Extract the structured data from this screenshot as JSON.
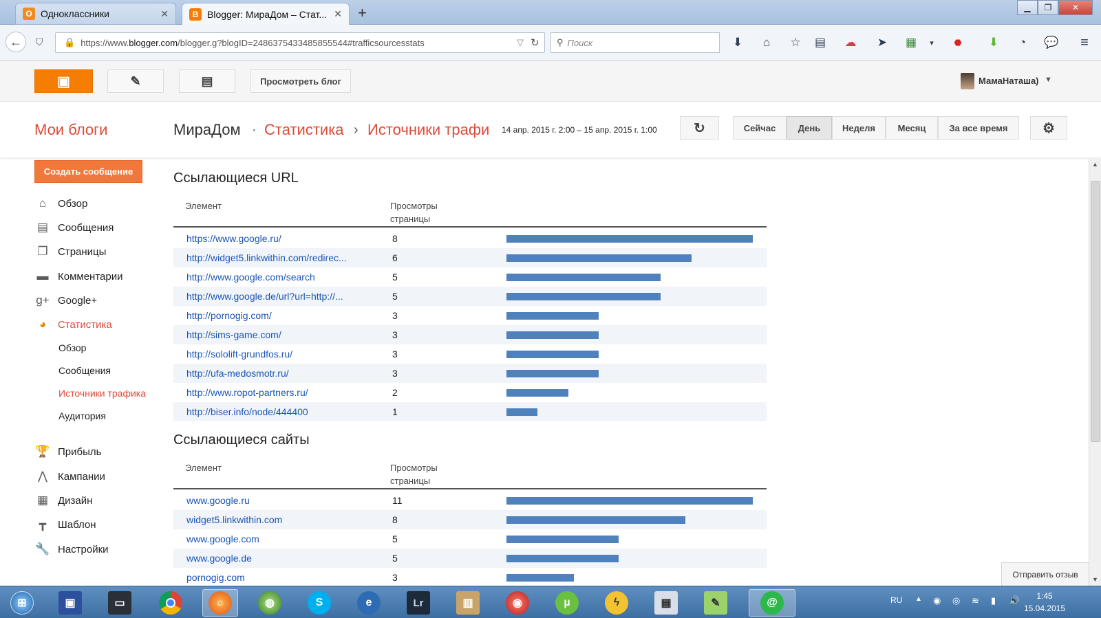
{
  "browser": {
    "tabs": [
      {
        "title": "Одноклассники",
        "icon_color": "#ef8b1f",
        "icon": "ok-icon"
      },
      {
        "title": "Blogger: МираДом – Стат...",
        "icon_color": "#f57d00",
        "icon": "blogger-icon"
      }
    ],
    "url_prefix": "https://www.",
    "url_host": "blogger.com",
    "url_rest": "/blogger.g?blogID=2486375433485855544#trafficsourcesstats",
    "search_placeholder": "Поиск"
  },
  "header": {
    "view_blog_label": "Просмотреть блог",
    "username": "МамаНаташа)"
  },
  "titlebar": {
    "my_blogs": "Мои блоги",
    "blog_name": "МираДом",
    "sep1": "·",
    "crumb_stats": "Статистика",
    "sep2": "›",
    "crumb_traffic": "Источники трафи",
    "date_range": "14 апр. 2015 г. 2:00 – 15 апр. 2015 г. 1:00",
    "periods": [
      "Сейчас",
      "День",
      "Неделя",
      "Месяц",
      "За все время"
    ],
    "active_period": "День"
  },
  "sidebar": {
    "create_label": "Создать сообщение",
    "items": [
      {
        "label": "Обзор",
        "icon": "home-icon"
      },
      {
        "label": "Сообщения",
        "icon": "posts-icon"
      },
      {
        "label": "Страницы",
        "icon": "pages-icon"
      },
      {
        "label": "Комментарии",
        "icon": "comments-icon"
      },
      {
        "label": "Google+",
        "icon": "google-plus-icon"
      },
      {
        "label": "Статистика",
        "icon": "stats-icon"
      }
    ],
    "subitems": [
      "Обзор",
      "Сообщения",
      "Источники трафика",
      "Аудитория"
    ],
    "active_subitem": "Источники трафика",
    "items2": [
      {
        "label": "Прибыль",
        "icon": "trophy-icon"
      },
      {
        "label": "Кампании",
        "icon": "campaigns-icon"
      },
      {
        "label": "Дизайн",
        "icon": "layout-icon"
      },
      {
        "label": "Шаблон",
        "icon": "template-icon"
      },
      {
        "label": "Настройки",
        "icon": "wrench-icon"
      }
    ]
  },
  "urls": {
    "title": "Ссылающиеся URL",
    "col_item": "Элемент",
    "col_views_1": "Просмотры",
    "col_views_2": "страницы",
    "max": 8,
    "rows": [
      {
        "url": "https://www.google.ru/",
        "views": 8
      },
      {
        "url": "http://widget5.linkwithin.com/redirec...",
        "views": 6
      },
      {
        "url": "http://www.google.com/search",
        "views": 5
      },
      {
        "url": "http://www.google.de/url?url=http://...",
        "views": 5
      },
      {
        "url": "http://pornogig.com/",
        "views": 3
      },
      {
        "url": "http://sims-game.com/",
        "views": 3
      },
      {
        "url": "http://sololift-grundfos.ru/",
        "views": 3
      },
      {
        "url": "http://ufa-medosmotr.ru/",
        "views": 3
      },
      {
        "url": "http://www.ropot-partners.ru/",
        "views": 2
      },
      {
        "url": "http://biser.info/node/444400",
        "views": 1
      }
    ]
  },
  "sites": {
    "title": "Ссылающиеся сайты",
    "col_item": "Элемент",
    "col_views_1": "Просмотры",
    "col_views_2": "страницы",
    "max": 11,
    "rows": [
      {
        "site": "www.google.ru",
        "views": 11
      },
      {
        "site": "widget5.linkwithin.com",
        "views": 8
      },
      {
        "site": "www.google.com",
        "views": 5
      },
      {
        "site": "www.google.de",
        "views": 5
      },
      {
        "site": "pornogig.com",
        "views": 3
      }
    ]
  },
  "feedback_label": "Отправить отзыв",
  "taskbar": {
    "lang": "RU",
    "time": "1:45",
    "date": "15.04.2015"
  },
  "colors": {
    "accent": "#dd4b39",
    "bar": "#4f81bd",
    "link": "#1a55b5"
  }
}
